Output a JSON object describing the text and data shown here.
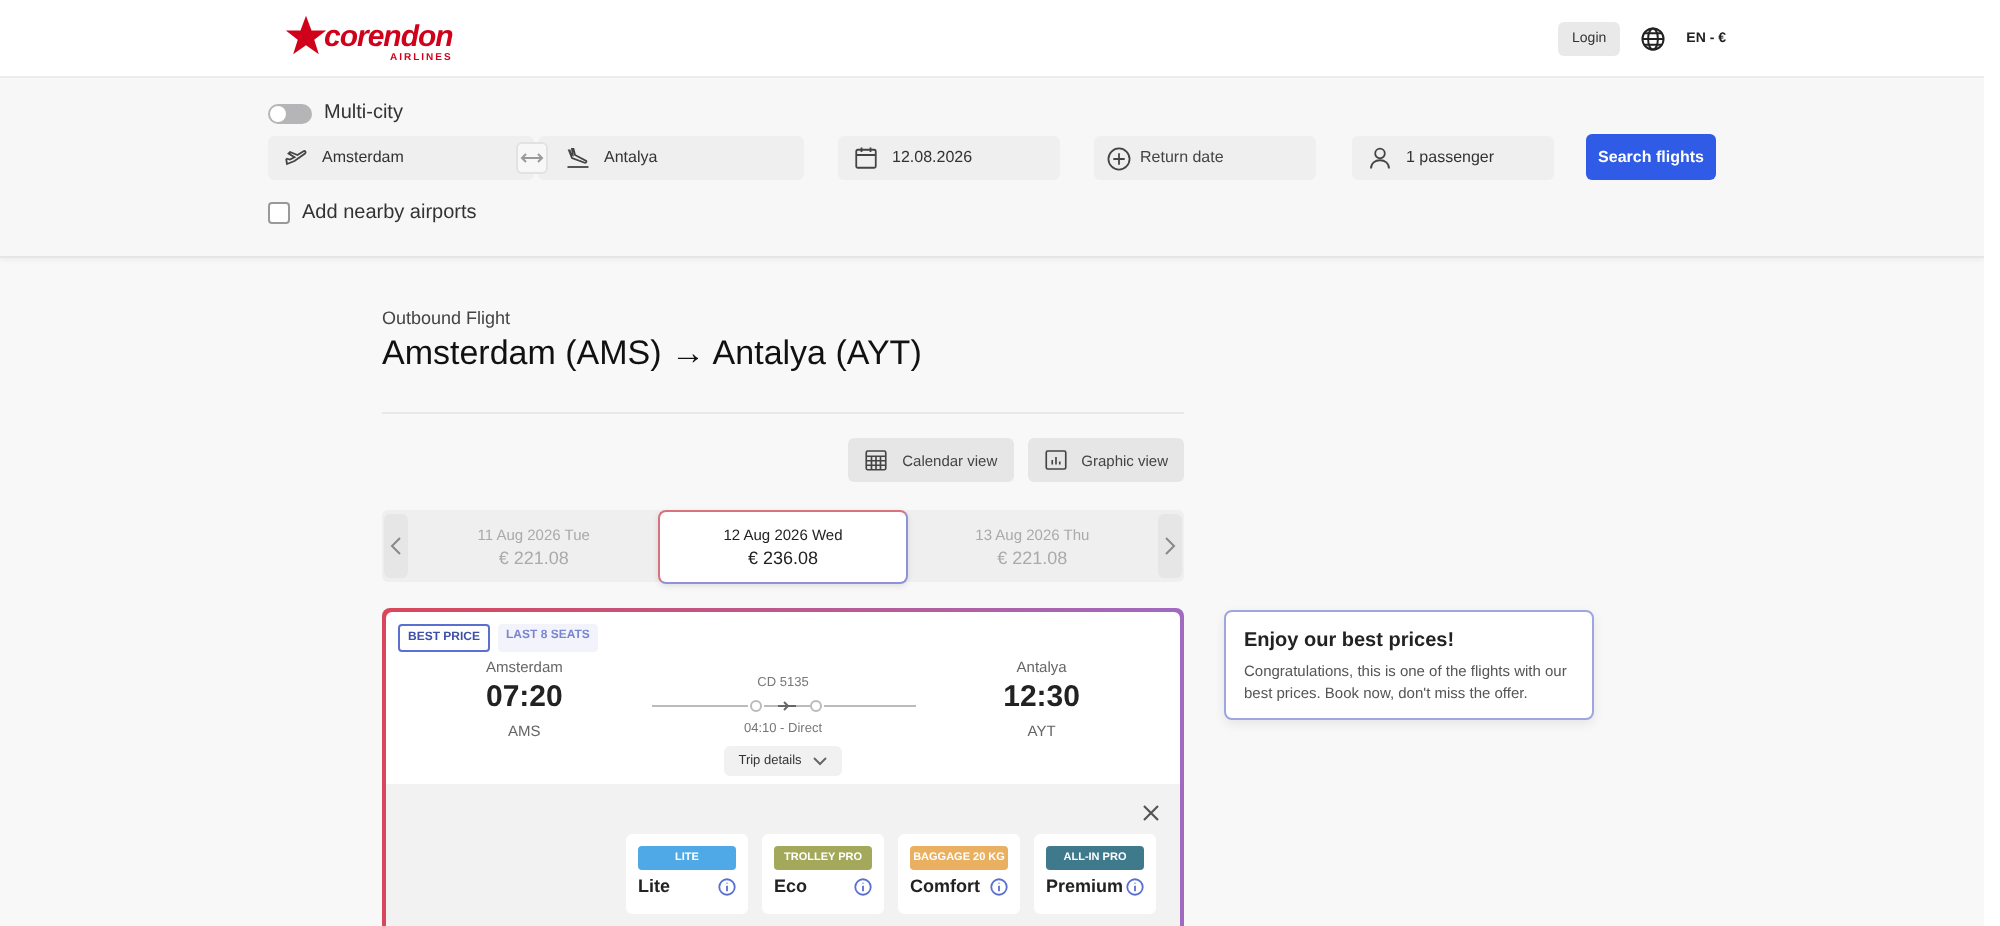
{
  "header": {
    "logo_text": "corendon",
    "logo_subtext": "AIRLINES",
    "login": "Login",
    "language": "EN - €"
  },
  "search": {
    "multi_city": {
      "label": "Multi-city",
      "on": false
    },
    "origin": "Amsterdam",
    "destination": "Antalya",
    "depart_date": "12.08.2026",
    "return_placeholder": "Return date",
    "passengers": "1 passenger",
    "search_button": "Search flights",
    "nearby": {
      "label": "Add nearby airports",
      "checked": false
    }
  },
  "outbound": {
    "label": "Outbound Flight",
    "title": "Amsterdam (AMS) → Antalya (AYT)"
  },
  "views": [
    {
      "label": "Calendar view",
      "kind": "calendar"
    },
    {
      "label": "Graphic view",
      "kind": "graphic"
    }
  ],
  "dates": [
    {
      "date": "11 Aug 2026 Tue",
      "price": "€ 221.08",
      "selected": false
    },
    {
      "date": "12 Aug 2026 Wed",
      "price": "€ 236.08",
      "selected": true
    },
    {
      "date": "13 Aug 2026 Thu",
      "price": "€ 221.08",
      "selected": false
    }
  ],
  "flight": {
    "tags": [
      {
        "label": "BEST PRICE",
        "kind": "best"
      },
      {
        "label": "LAST 8 SEATS",
        "kind": "seats"
      }
    ],
    "departure": {
      "city": "Amsterdam",
      "time": "07:20",
      "code": "AMS"
    },
    "arrival": {
      "city": "Antalya",
      "time": "12:30",
      "code": "AYT"
    },
    "flight_no": "CD 5135",
    "duration": "04:10 - Direct",
    "trip_details": "Trip details"
  },
  "fares": [
    {
      "badge": "LITE",
      "color": "#4fa9e6",
      "name": "Lite"
    },
    {
      "badge": "TROLLEY PRO",
      "color": "#a3a85a",
      "name": "Eco"
    },
    {
      "badge": "BAGGAGE 20 KG",
      "color": "#e8b060",
      "name": "Comfort"
    },
    {
      "badge": "ALL-IN PRO",
      "color": "#3e7a8c",
      "name": "Premium"
    }
  ],
  "tooltip": {
    "title": "Enjoy our best prices!",
    "text": "Congratulations, this is one of the flights with our best prices. Book now, don't miss the offer."
  }
}
